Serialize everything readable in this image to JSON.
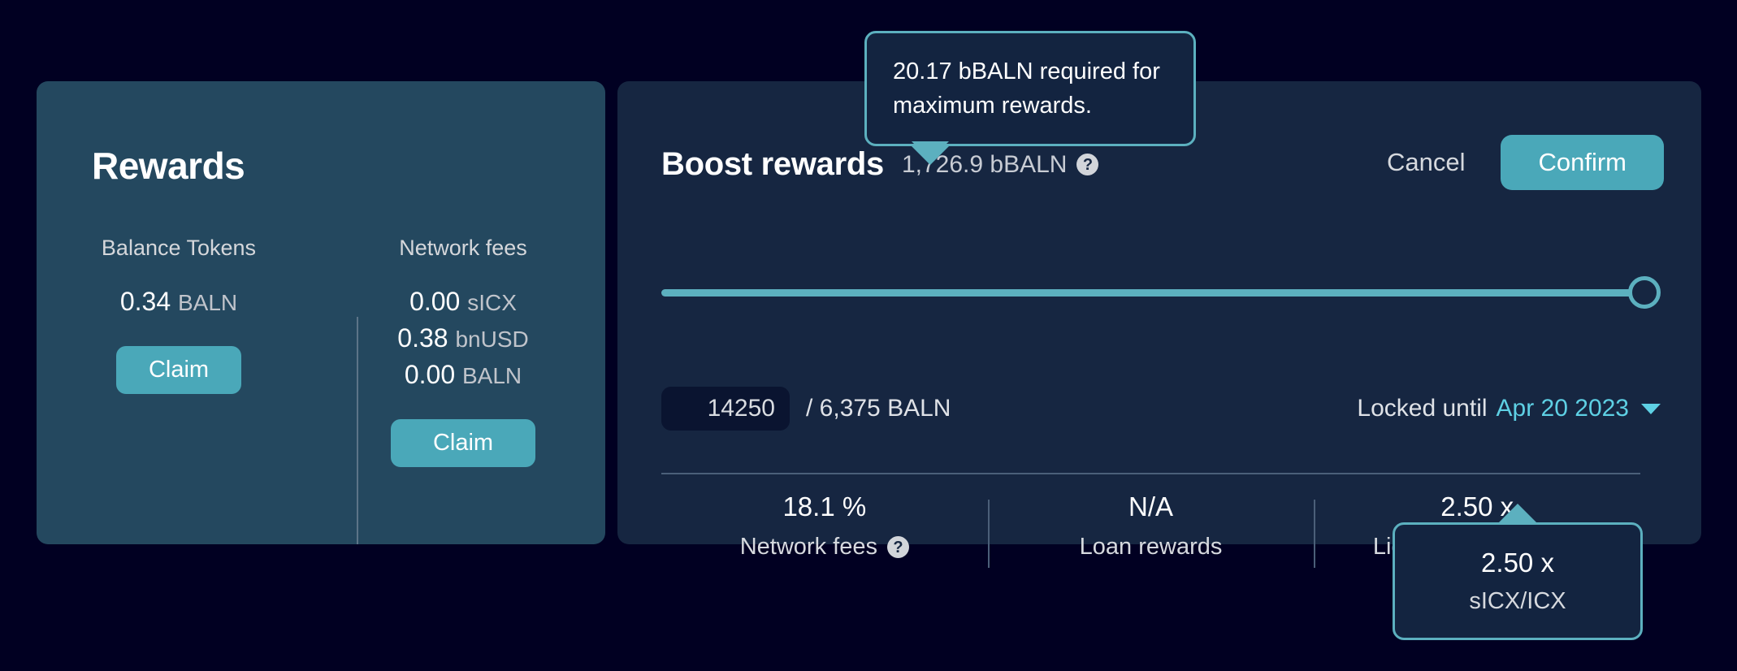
{
  "rewards": {
    "title": "Rewards",
    "columns": [
      {
        "heading": "Balance Tokens",
        "lines": [
          {
            "value": "0.34",
            "unit": "BALN"
          }
        ],
        "claim_label": "Claim"
      },
      {
        "heading": "Network fees",
        "lines": [
          {
            "value": "0.00",
            "unit": "sICX"
          },
          {
            "value": "0.38",
            "unit": "bnUSD"
          },
          {
            "value": "0.00",
            "unit": "BALN"
          }
        ],
        "claim_label": "Claim"
      }
    ]
  },
  "boost": {
    "title": "Boost rewards",
    "amount": "1,726.9 bBALN",
    "help_icon": "question-mark-icon",
    "cancel_label": "Cancel",
    "confirm_label": "Confirm",
    "slider": {
      "percent": 100
    },
    "input_value": "14250",
    "total_label": "/ 6,375 BALN",
    "locked_prefix": "Locked until",
    "locked_date": "Apr 20 2023",
    "caret_icon": "chevron-down-icon",
    "stats": [
      {
        "value": "18.1 %",
        "label": "Network fees",
        "has_help": true
      },
      {
        "value": "N/A",
        "label": "Loan rewards",
        "has_help": false
      },
      {
        "value": "2.50 x",
        "label": "Liquidity rewards",
        "has_help": true
      }
    ]
  },
  "tooltips": {
    "top": {
      "text": "20.17 bBALN required for maximum rewards."
    },
    "bottom": {
      "value": "2.50 x",
      "label": "sICX/ICX"
    }
  },
  "colors": {
    "page_bg": "#010022",
    "left_panel": "#24485f",
    "right_panel": "#162641",
    "accent": "#4aa8b9",
    "accent_light": "#5cb0bf",
    "link": "#5ed0e4",
    "input_bg": "#0a1430"
  }
}
